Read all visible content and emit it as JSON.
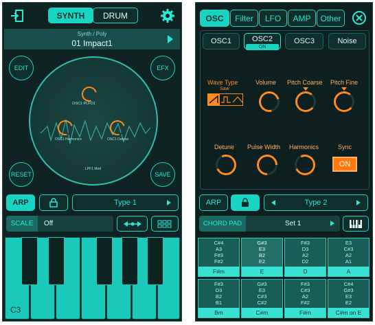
{
  "left": {
    "mode_tabs": [
      "SYNTH",
      "DRUM"
    ],
    "preset_category": "Synth / Poly",
    "preset_name": "01 Impact1",
    "corner_buttons": {
      "edit": "EDIT",
      "efx": "EFX",
      "reset": "RESET",
      "save": "SAVE"
    },
    "knob_labels": {
      "top": "OSC1 PLFO1",
      "left": "OSC1 Harmonics",
      "right": "OSC1 Detune",
      "bottom": "LPF1 Mod"
    },
    "arp_label": "ARP",
    "arp_type": "Type 1",
    "scale_label": "SCALE",
    "scale_value": "Off",
    "key_label": "C3"
  },
  "right": {
    "tabs": [
      "OSC",
      "Filter",
      "LFO",
      "AMP",
      "Other"
    ],
    "osc_tabs": [
      "OSC1",
      "OSC2",
      "OSC3",
      "Noise"
    ],
    "osc2_state": "ON",
    "params_row1": [
      "Wave Type",
      "Volume",
      "Pitch Coarse",
      "Pitch Fine"
    ],
    "wave_type_value": "Saw",
    "params_row2": [
      "Detune",
      "Pulse Width",
      "Harmonics",
      "Sync"
    ],
    "sync_state": "ON",
    "arp_label": "ARP",
    "arp_type": "Type 2",
    "chord_pad_label": "CHORD PAD",
    "chord_set": "Set 1",
    "chords": [
      {
        "notes": "C#4\nA3\nF#3\nF#2",
        "name": "F#m"
      },
      {
        "notes": "G#3\nE3\nB2\nE2",
        "name": "E"
      },
      {
        "notes": "F#3\nD3\nA2\nD2",
        "name": "D"
      },
      {
        "notes": "E3\nC#3\nA2\nA1",
        "name": "A"
      },
      {
        "notes": "F#3\nD3\nB2\nB1",
        "name": "Bm"
      },
      {
        "notes": "G#3\nE3\nC#3\nC#2",
        "name": "C#m"
      },
      {
        "notes": "F#3\nC#3\nA2\nF#2",
        "name": "F#m"
      },
      {
        "notes": "C#4\nG#3\nE3\nE2",
        "name": "C#m on E"
      }
    ]
  }
}
